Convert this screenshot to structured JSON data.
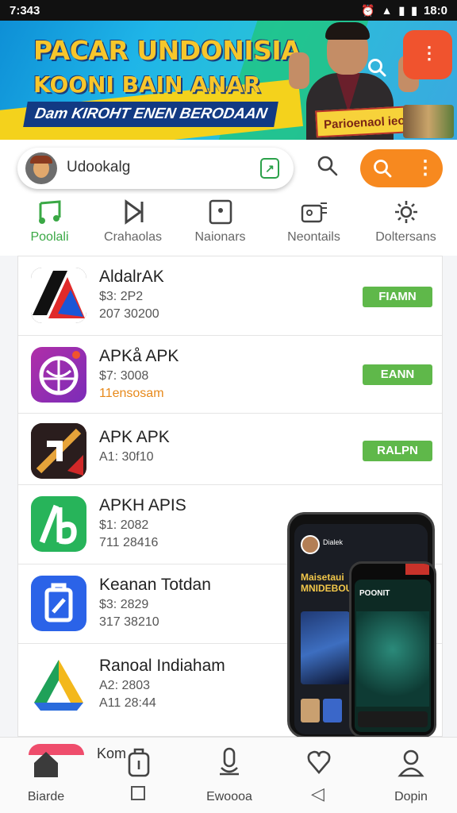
{
  "status_bar": {
    "time": "7:343",
    "right_time": "18:0",
    "wifi_icon": "wifi-icon",
    "battery_icon": "battery-icon"
  },
  "banner": {
    "line1": "PACAR UNDONISIA",
    "line2": "KOONI BAIN ANAR",
    "line3": "Dam KIROHT ENEN BERODAAN",
    "promo": "Parioenaol ieoo"
  },
  "search": {
    "placeholder": "Udookalg"
  },
  "tabs": [
    {
      "label": "Poolali",
      "icon": "music-note-icon"
    },
    {
      "label": "Crahaolas",
      "icon": "play-icon"
    },
    {
      "label": "Naionars",
      "icon": "news-icon"
    },
    {
      "label": "Neontails",
      "icon": "gamepad-icon"
    },
    {
      "label": "Doltersans",
      "icon": "settings-cog-icon"
    }
  ],
  "apps": [
    {
      "name": "AldalrAK",
      "meta1": "$3: 2P2",
      "meta2": "207 30200",
      "button": "FIAMN",
      "icon": "aldalrak-app-icon"
    },
    {
      "name": "APKå APK",
      "meta1": "$7: 3008",
      "meta2": "11ensosam",
      "button": "EANN",
      "icon": "apk-globe-app-icon"
    },
    {
      "name": "APK APK",
      "meta1": "A1: 30f10",
      "meta2": "",
      "button": "RALPN",
      "icon": "apk-arrow-app-icon"
    },
    {
      "name": "APKH APIS",
      "meta1": "$1: 2082",
      "meta2": "711 28416",
      "button": "",
      "icon": "apkh-app-icon"
    },
    {
      "name": "Keanan Totdan",
      "meta1": "$3: 2829",
      "meta2": "317 38210",
      "button": "",
      "icon": "keanan-app-icon"
    },
    {
      "name": "Ranoal Indiaham",
      "meta1": "A2: 2803",
      "meta2": "A11 28:44",
      "button": "",
      "icon": "ranoal-app-icon"
    }
  ],
  "phone_mockup": {
    "back_text": "Dialek",
    "back_title": "Maisetaui MNIDEBOUOES",
    "front_title": "POONIT"
  },
  "bottom_nav": {
    "peek_text": "Kom",
    "items": [
      {
        "label": "Biarde",
        "icon": "home-icon"
      },
      {
        "label": "",
        "icon": "shield-bag-icon"
      },
      {
        "label": "Ewoooa",
        "icon": "mic-device-icon"
      },
      {
        "label": "",
        "icon": "heart-chat-icon"
      },
      {
        "label": "Dopin",
        "icon": "user-icon"
      }
    ]
  },
  "colors": {
    "accent_green": "#5fb84a",
    "accent_orange": "#f7891f",
    "tab_active": "#3aa845"
  }
}
